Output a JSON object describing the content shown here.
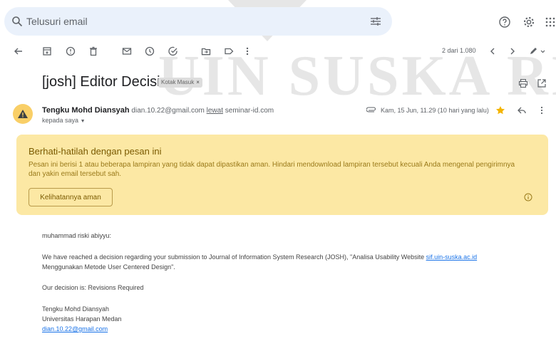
{
  "search": {
    "placeholder": "Telusuri email"
  },
  "toolbar": {
    "pager": "2 dari 1.080"
  },
  "message": {
    "subject": "[josh] Editor Decision",
    "label": "Kotak Masuk",
    "label_close": "×",
    "sender_name": "Tengku Mohd Diansyah",
    "sender_email": "dian.10.22@gmail.com",
    "via_word": "lewat",
    "via_domain": "seminar-id.com",
    "recipient": "kepada saya",
    "datetime": "Kam, 15 Jun, 11.29 (10 hari yang lalu)"
  },
  "warning": {
    "title": "Berhati-hatilah dengan pesan ini",
    "body": "Pesan ini berisi 1 atau beberapa lampiran yang tidak dapat dipastikan aman. Hindari mendownload lampiran tersebut kecuali Anda mengenal pengirimnya dan yakin email tersebut sah.",
    "button": "Kelihatannya aman"
  },
  "body": {
    "greeting": "muhammad riski abiyyu:",
    "line1_a": "We have reached a decision regarding your submission to Journal of Information System Research (JOSH), \"Analisa Usability Website ",
    "line1_link": "sif.uin-suska.ac.id",
    "line2": "Menggunakan Metode User Centered Design\".",
    "decision": "Our decision is: Revisions Required",
    "sig_name": "Tengku Mohd Diansyah",
    "sig_org": "Universitas Harapan Medan",
    "sig_email": "dian.10.22@gmail.com"
  },
  "watermark": {
    "text": "UIN SUSKA RI"
  },
  "colors": {
    "accent_blue": "#1a73e8",
    "warning_bg": "#fce8a4",
    "avatar_bg": "#f9cf67",
    "star": "#f4b400"
  },
  "icons": [
    "search-icon",
    "tune-icon",
    "help-icon",
    "gear-icon",
    "apps-icon",
    "back-icon",
    "archive-icon",
    "report-spam-icon",
    "delete-icon",
    "mark-unread-icon",
    "snooze-icon",
    "add-task-icon",
    "move-to-icon",
    "label-icon",
    "more-vert-icon",
    "prev-icon",
    "next-icon",
    "pen-icon",
    "print-icon",
    "open-new-window-icon",
    "warning-icon",
    "attachment-icon",
    "star-icon",
    "reply-icon",
    "info-icon"
  ]
}
